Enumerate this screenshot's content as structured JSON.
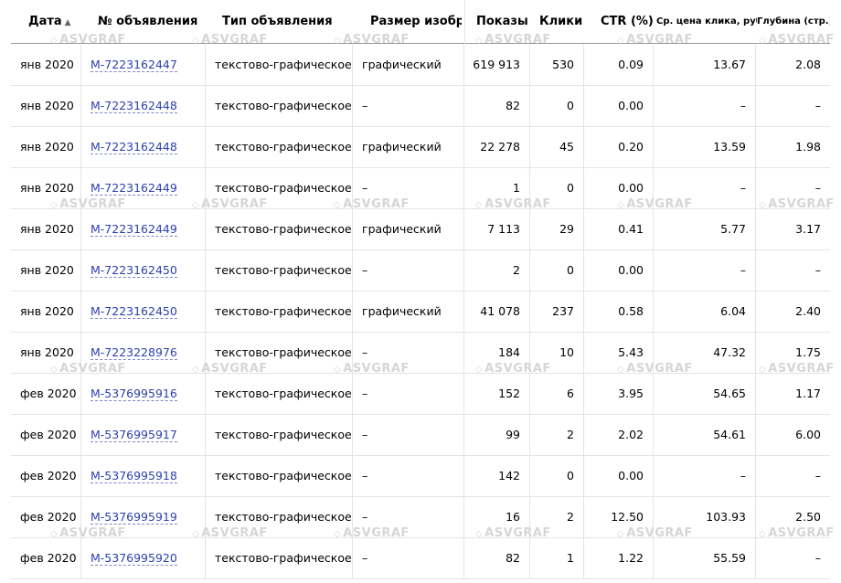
{
  "headers": {
    "date": "Дата",
    "ad_id": "№ объявления",
    "ad_type": "Тип объявления",
    "image_size": "Размер изображ",
    "impressions": "Показы",
    "clicks": "Клики",
    "ctr": "CTR (%)",
    "avg_cpc": "Ср. цена клика, руб.",
    "depth": "Глубина (стр.)"
  },
  "sort_indicator": "▲",
  "watermark": "ASVGRAF",
  "rows": [
    {
      "date": "янв 2020",
      "ad_id": "M-7223162447",
      "ad_type": "текстово-графическое",
      "image_size": "графический",
      "impressions": "619 913",
      "clicks": "530",
      "ctr": "0.09",
      "avg_cpc": "13.67",
      "depth": "2.08"
    },
    {
      "date": "янв 2020",
      "ad_id": "M-7223162448",
      "ad_type": "текстово-графическое",
      "image_size": "–",
      "impressions": "82",
      "clicks": "0",
      "ctr": "0.00",
      "avg_cpc": "–",
      "depth": "–"
    },
    {
      "date": "янв 2020",
      "ad_id": "M-7223162448",
      "ad_type": "текстово-графическое",
      "image_size": "графический",
      "impressions": "22 278",
      "clicks": "45",
      "ctr": "0.20",
      "avg_cpc": "13.59",
      "depth": "1.98"
    },
    {
      "date": "янв 2020",
      "ad_id": "M-7223162449",
      "ad_type": "текстово-графическое",
      "image_size": "–",
      "impressions": "1",
      "clicks": "0",
      "ctr": "0.00",
      "avg_cpc": "–",
      "depth": "–"
    },
    {
      "date": "янв 2020",
      "ad_id": "M-7223162449",
      "ad_type": "текстово-графическое",
      "image_size": "графический",
      "impressions": "7 113",
      "clicks": "29",
      "ctr": "0.41",
      "avg_cpc": "5.77",
      "depth": "3.17"
    },
    {
      "date": "янв 2020",
      "ad_id": "M-7223162450",
      "ad_type": "текстово-графическое",
      "image_size": "–",
      "impressions": "2",
      "clicks": "0",
      "ctr": "0.00",
      "avg_cpc": "–",
      "depth": "–"
    },
    {
      "date": "янв 2020",
      "ad_id": "M-7223162450",
      "ad_type": "текстово-графическое",
      "image_size": "графический",
      "impressions": "41 078",
      "clicks": "237",
      "ctr": "0.58",
      "avg_cpc": "6.04",
      "depth": "2.40"
    },
    {
      "date": "янв 2020",
      "ad_id": "M-7223228976",
      "ad_type": "текстово-графическое",
      "image_size": "–",
      "impressions": "184",
      "clicks": "10",
      "ctr": "5.43",
      "avg_cpc": "47.32",
      "depth": "1.75"
    },
    {
      "date": "фев 2020",
      "ad_id": "M-5376995916",
      "ad_type": "текстово-графическое",
      "image_size": "–",
      "impressions": "152",
      "clicks": "6",
      "ctr": "3.95",
      "avg_cpc": "54.65",
      "depth": "1.17"
    },
    {
      "date": "фев 2020",
      "ad_id": "M-5376995917",
      "ad_type": "текстово-графическое",
      "image_size": "–",
      "impressions": "99",
      "clicks": "2",
      "ctr": "2.02",
      "avg_cpc": "54.61",
      "depth": "6.00"
    },
    {
      "date": "фев 2020",
      "ad_id": "M-5376995918",
      "ad_type": "текстово-графическое",
      "image_size": "–",
      "impressions": "142",
      "clicks": "0",
      "ctr": "0.00",
      "avg_cpc": "–",
      "depth": "–"
    },
    {
      "date": "фев 2020",
      "ad_id": "M-5376995919",
      "ad_type": "текстово-графическое",
      "image_size": "–",
      "impressions": "16",
      "clicks": "2",
      "ctr": "12.50",
      "avg_cpc": "103.93",
      "depth": "2.50"
    },
    {
      "date": "фев 2020",
      "ad_id": "M-5376995920",
      "ad_type": "текстово-графическое",
      "image_size": "–",
      "impressions": "82",
      "clicks": "1",
      "ctr": "1.22",
      "avg_cpc": "55.59",
      "depth": "–"
    }
  ]
}
